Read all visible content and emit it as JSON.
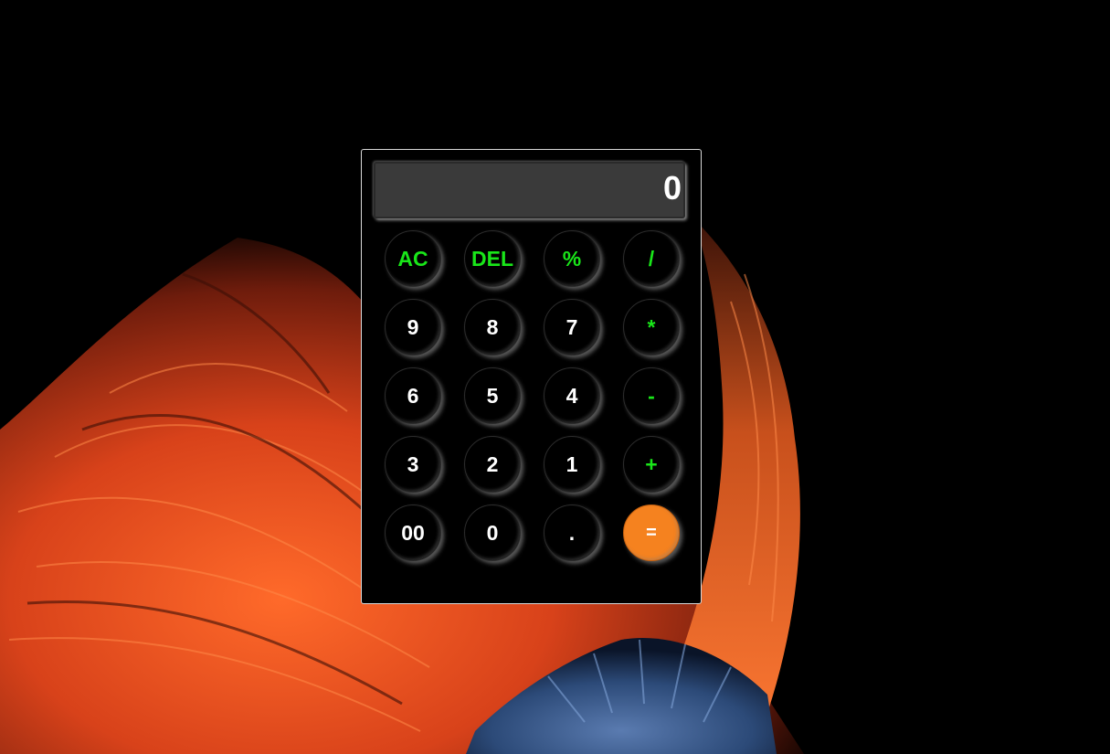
{
  "calculator": {
    "display_value": "0",
    "keys": [
      {
        "label": "AC",
        "name": "clear-all-key",
        "type": "op"
      },
      {
        "label": "DEL",
        "name": "delete-key",
        "type": "op"
      },
      {
        "label": "%",
        "name": "percent-key",
        "type": "op"
      },
      {
        "label": "/",
        "name": "divide-key",
        "type": "op"
      },
      {
        "label": "9",
        "name": "digit-9-key",
        "type": "num"
      },
      {
        "label": "8",
        "name": "digit-8-key",
        "type": "num"
      },
      {
        "label": "7",
        "name": "digit-7-key",
        "type": "num"
      },
      {
        "label": "*",
        "name": "multiply-key",
        "type": "op"
      },
      {
        "label": "6",
        "name": "digit-6-key",
        "type": "num"
      },
      {
        "label": "5",
        "name": "digit-5-key",
        "type": "num"
      },
      {
        "label": "4",
        "name": "digit-4-key",
        "type": "num"
      },
      {
        "label": "-",
        "name": "subtract-key",
        "type": "op"
      },
      {
        "label": "3",
        "name": "digit-3-key",
        "type": "num"
      },
      {
        "label": "2",
        "name": "digit-2-key",
        "type": "num"
      },
      {
        "label": "1",
        "name": "digit-1-key",
        "type": "num"
      },
      {
        "label": "+",
        "name": "add-key",
        "type": "op"
      },
      {
        "label": "00",
        "name": "double-zero-key",
        "type": "num"
      },
      {
        "label": "0",
        "name": "digit-0-key",
        "type": "num"
      },
      {
        "label": ".",
        "name": "decimal-point-key",
        "type": "num"
      },
      {
        "label": "=",
        "name": "equals-key",
        "type": "equals"
      }
    ]
  },
  "colors": {
    "operator_text": "#19e619",
    "equals_background": "#f5821f",
    "display_background": "#3a3a3a"
  }
}
